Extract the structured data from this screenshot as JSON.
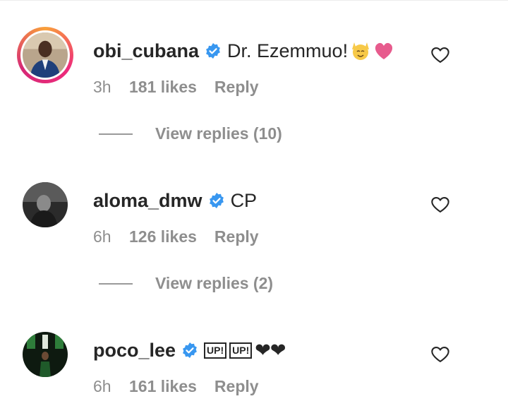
{
  "comments": [
    {
      "username": "obi_cubana",
      "text": "Dr. Ezemmuo!",
      "emoji_icons": [
        "raising-hands-emoji-icon",
        "pink-heart-emoji-icon"
      ],
      "time": "3h",
      "likes": "181 likes",
      "reply_label": "Reply",
      "view_replies": "View replies (10)"
    },
    {
      "username": "aloma_dmw",
      "text": "CP",
      "time": "6h",
      "likes": "126 likes",
      "reply_label": "Reply",
      "view_replies": "View replies (2)"
    },
    {
      "username": "poco_lee",
      "up1": "UP!",
      "up2": "UP!",
      "hearts": "❤❤",
      "time": "6h",
      "likes": "161 likes",
      "reply_label": "Reply"
    }
  ],
  "colors": {
    "verified_blue": "#3897f0",
    "secondary_text": "#8e8e8e",
    "primary_text": "#262626",
    "story_ring": [
      "#f9a13a",
      "#ee2a7b"
    ]
  }
}
